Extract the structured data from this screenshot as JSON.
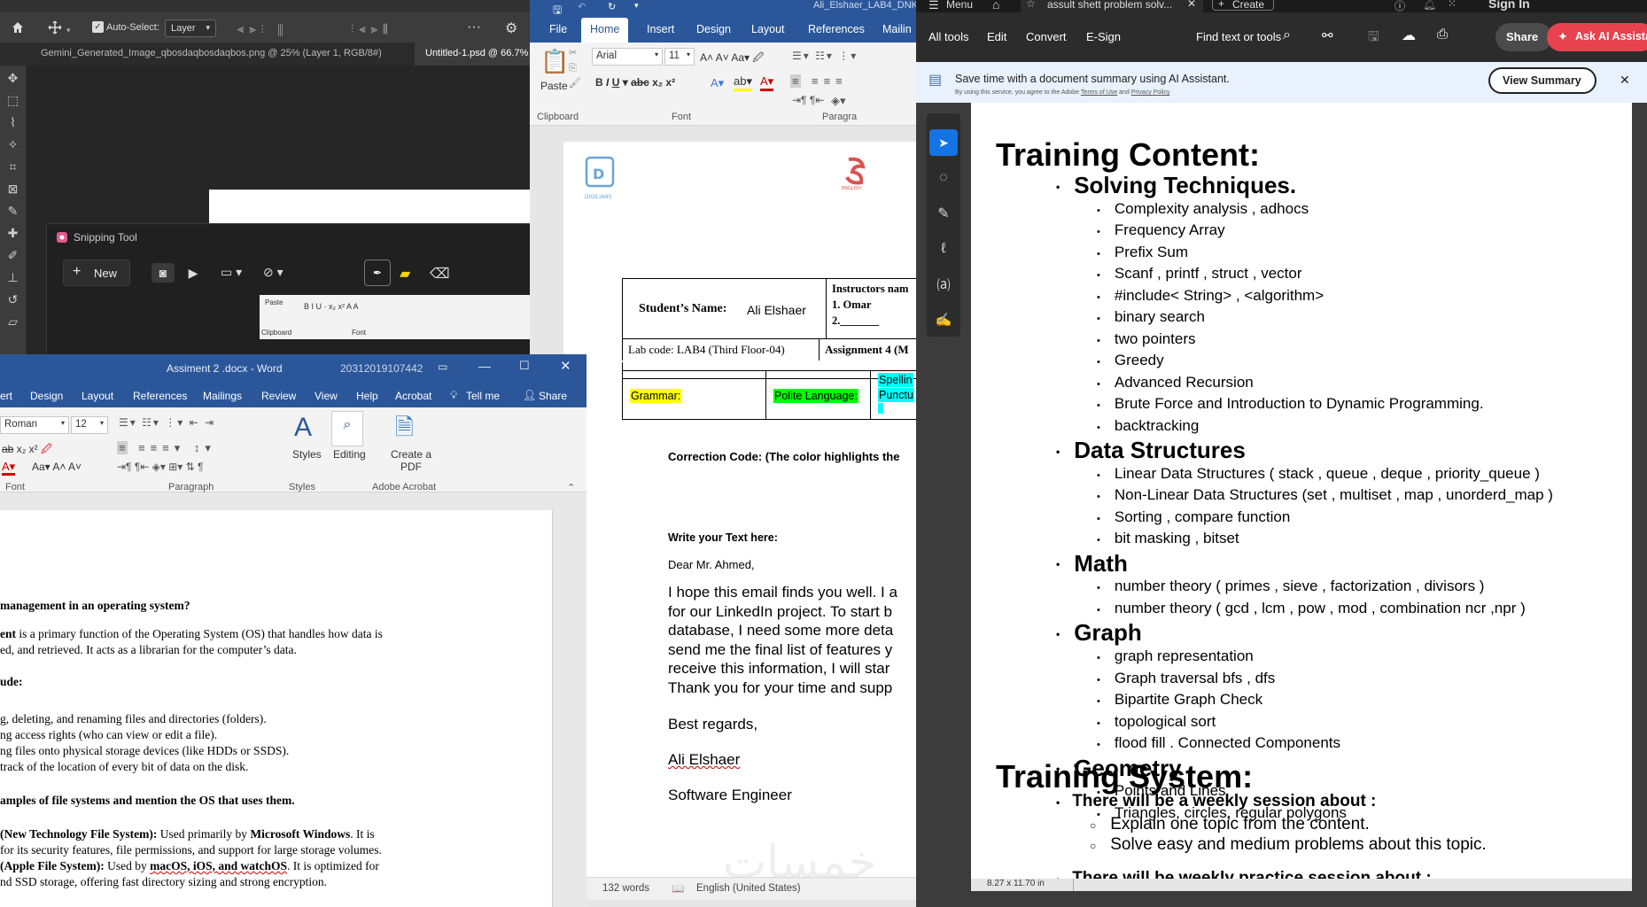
{
  "photoshop": {
    "autoselect_label": "Auto-Select:",
    "layer_select": "Layer",
    "tabs": [
      {
        "label": "Gemini_Generated_Image_qbosdaqbosdaqbos.png @ 25% (Layer 1, RGB/8#)"
      },
      {
        "label": "Untitled-1.psd @ 66.7%"
      }
    ]
  },
  "snipping": {
    "title": "Snipping Tool",
    "new_label": "New",
    "mini_ribbon": {
      "paste": "Paste",
      "clipboard": "Clipboard",
      "font": "Font"
    }
  },
  "word_front": {
    "title": "Assiment 2 .docx - Word",
    "number": "20312019107442",
    "tabs": [
      "ert",
      "Design",
      "Layout",
      "References",
      "Mailings",
      "Review",
      "View",
      "Help",
      "Acrobat",
      "Tell me",
      "Share"
    ],
    "font_name": "Roman",
    "font_size": "12",
    "groups": {
      "font": "Font",
      "paragraph": "Paragraph",
      "styles": "Styles",
      "adobe": "Adobe Acrobat"
    },
    "styles_label": "Styles",
    "editing_label": "Editing",
    "create_pdf_label": "Create a PDF",
    "doc": {
      "q1": "management in an operating system?",
      "p1a": "ent",
      "p1b": " is a primary function of the Operating System (OS) that handles how data is",
      "p2": "ed, and retrieved. It acts as a librarian for the computer’s data.",
      "h_include": "ude:",
      "l1": "g, deleting, and renaming files and directories (folders).",
      "l2": "ng access rights (who can view or edit a file).",
      "l3": "ng files onto physical storage devices (like HDDs or SSDS).",
      "l4": "track of the location of every bit of data on the disk.",
      "q2": "amples of file systems and mention the OS that uses them.",
      "ntfs_a": "(New Technology File System):",
      "ntfs_b": " Used primarily by ",
      "ntfs_c": "Microsoft Windows",
      "ntfs_d": ". It is",
      "ntfs_e": "for its security features, file permissions, and support for large storage volumes.",
      "apfs_a": "(Apple File System):",
      "apfs_b": " Used by ",
      "apfs_c": "macOS, iOS, and watchOS",
      "apfs_d": ". It is optimized for",
      "apfs_e": "nd SSD storage, offering fast directory sizing and strong encryption."
    }
  },
  "word_back": {
    "title": "Ali_Elshaer_LAB4_DNK",
    "tabs": [
      "File",
      "Home",
      "Insert",
      "Design",
      "Layout",
      "References",
      "Mailin"
    ],
    "font_name": "Arial",
    "font_size": "11",
    "paste_label": "Paste",
    "groups": {
      "clipboard": "Clipboard",
      "font": "Font",
      "paragraph": "Paragra"
    },
    "doc": {
      "student_label": "Student’s Name:",
      "student_name": "Ali Elshaer",
      "instructors": "Instructors nam",
      "inst1": "1. Omar",
      "inst2": "2._______",
      "lab_code": "Lab code: LAB4 (Third Floor-04)",
      "assignment": "Assignment 4 (M",
      "grammar": "Grammar:",
      "polite": "Polite Language:",
      "spelling1": "Spellin",
      "spelling2": "Punctu",
      "correction": "Correction Code: (The color highlights the",
      "write_here": "Write your Text here:",
      "greeting": "Dear Mr. Ahmed,",
      "body": [
        "I hope this email finds you well. I a",
        "for our LinkedIn project. To start b",
        "database, I need some more deta",
        "send me the final list of features y",
        "receive this information, I will star",
        "Thank you for your time and supp"
      ],
      "regards": "Best regards,",
      "signature": "Ali Elshaer",
      "role": "Software Engineer",
      "watermark": "خمسات"
    },
    "status": {
      "words": "132 words",
      "language": "English (United States)"
    }
  },
  "acrobat": {
    "tab_title": "assult shett problem solv...",
    "menu_label": "Menu",
    "create_label": "Create",
    "signin_label": "Sign In",
    "menu_items": [
      "All tools",
      "Edit",
      "Convert",
      "E-Sign"
    ],
    "find_label": "Find text or tools",
    "share_label": "Share",
    "ask_ai_label": "Ask AI Assista",
    "banner_title": "Save time with a document summary using AI Assistant.",
    "banner_sub_a": "By using this service, you agree to the Adobe",
    "banner_terms": "Terms of Use",
    "banner_and": "and",
    "banner_privacy": "Privacy Policy",
    "view_summary": "View Summary",
    "page_size": "8.27 x 11.70 in",
    "doc": {
      "h1": "Training Content:",
      "sections": [
        {
          "title": "Solving Techniques.",
          "items": [
            "Complexity analysis , adhocs",
            "Frequency Array",
            "Prefix Sum",
            "Scanf , printf , struct , vector",
            "#include< String>  , <algorithm>",
            "binary search",
            "two pointers",
            "Greedy",
            "Advanced Recursion",
            "Brute Force and Introduction  to Dynamic Programming.",
            "backtracking"
          ]
        },
        {
          "title": "Data Structures",
          "items": [
            "Linear Data Structures  ( stack , queue , deque , priority_queue  )",
            "Non-Linear Data Structures   (set , multiset ,  map , unorderd_map  )",
            "Sorting , compare function",
            "bit masking , bitset"
          ]
        },
        {
          "title": "Math",
          "items": [
            "number theory  ( primes , sieve , factorization , divisors  )",
            "number theory  ( gcd , lcm , pow , mod , combination ncr ,npr  )"
          ]
        },
        {
          "title": "Graph",
          "items": [
            "graph representation",
            "Graph traversal bfs , dfs",
            "Bipartite Graph Check",
            "topological sort",
            "flood fill . Connected Components"
          ]
        },
        {
          "title": "Geometry",
          "items": [
            "Points and Lines",
            "Triangles,  circles, regular polygons"
          ]
        }
      ],
      "h2": "Training System:",
      "sys_item": "There will be a weekly session about :",
      "sys_sub": [
        "Explain one topic from the content.",
        "Solve easy and medium problems about this topic."
      ],
      "sys_cut": "There will be weekly practice session about :"
    }
  },
  "colors": {
    "word_blue": "#2b579a",
    "grammar_yellow": "#ffff00",
    "polite_green": "#00ff00",
    "spelling_cyan": "#00ffff",
    "acro_ask_ai": "#e8424f"
  }
}
